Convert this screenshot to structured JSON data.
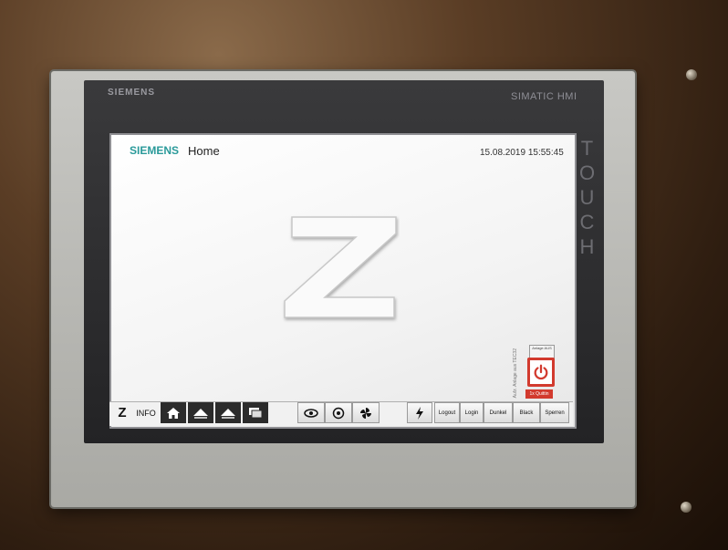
{
  "device": {
    "brand": "SIEMENS",
    "model_label": "SIMATIC HMI",
    "touch_label": "TOUCH"
  },
  "screen": {
    "header": {
      "brand": "SIEMENS",
      "page_title": "Home",
      "datetime": "15.08.2019 15:55:45"
    },
    "logo": {
      "letter": "Z"
    },
    "power_panel": {
      "vertical_text": "Aufz. Anlage aus TEC32",
      "anlage_label": "Anlage AUS",
      "power_icon": "power-icon",
      "quit_label": "1x Quittin"
    },
    "toolbar": {
      "z_label": "Z",
      "info_label": "INFO",
      "icons": [
        "home-icon",
        "up-icon",
        "up-icon",
        "windows-icon",
        "eye-icon",
        "config-icon",
        "fan-icon",
        "lightning-icon"
      ],
      "buttons": [
        "Logout",
        "Login",
        "Dunkel",
        "Black",
        "Sperren"
      ]
    }
  },
  "colors": {
    "accent": "#2a9a9a",
    "power": "#d23a2e"
  }
}
